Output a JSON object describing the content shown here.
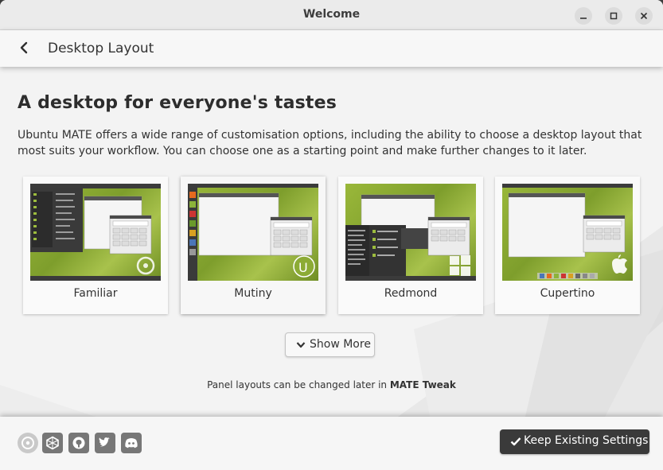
{
  "window": {
    "title": "Welcome"
  },
  "header": {
    "title": "Desktop Layout"
  },
  "main": {
    "heading": "A desktop for everyone's tastes",
    "description": "Ubuntu MATE offers a wide range of customisation options, including the ability to choose a desktop layout that most suits your workflow. You can choose one as a starting point and make further changes to it later.",
    "layouts": [
      {
        "label": "Familiar",
        "selected": false
      },
      {
        "label": "Mutiny",
        "selected": true
      },
      {
        "label": "Redmond",
        "selected": false
      },
      {
        "label": "Cupertino",
        "selected": false
      }
    ],
    "show_more_label": "Show More",
    "note_prefix": "Panel layouts can be changed later in",
    "note_bold": "MATE Tweak"
  },
  "footer": {
    "icons": [
      "ubuntu-mate-icon",
      "community-icon",
      "github-icon",
      "twitter-icon",
      "discord-icon"
    ],
    "keep_label": "Keep Existing Settings"
  },
  "colors": {
    "accent_dark": "#3a3a3a",
    "wallpaper_green": "#87a632"
  }
}
